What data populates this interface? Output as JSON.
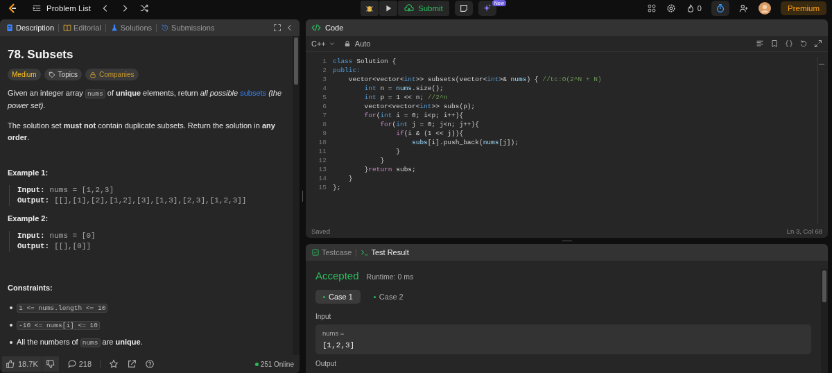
{
  "top_bar": {
    "problem_list": "Problem List",
    "submit": "Submit",
    "new_badge": "New",
    "streak": "0",
    "premium": "Premium"
  },
  "left_tabs": [
    {
      "label": "Description",
      "selected": true
    },
    {
      "label": "Editorial",
      "selected": false
    },
    {
      "label": "Solutions",
      "selected": false
    },
    {
      "label": "Submissions",
      "selected": false
    }
  ],
  "problem": {
    "title": "78. Subsets",
    "difficulty": "Medium",
    "topics": "Topics",
    "companies": "Companies",
    "statement": [
      {
        "kind": "text",
        "text": "Given an integer array "
      },
      {
        "kind": "code",
        "text": "nums"
      },
      {
        "kind": "text",
        "text": " of **unique** elements, return *all possible* "
      },
      {
        "kind": "link",
        "text": "subsets"
      },
      {
        "kind": "text",
        "text": " *(the power set)*."
      }
    ],
    "note": "The solution set **must not** contain duplicate subsets. Return the solution in **any order**.",
    "examples": [
      {
        "heading": "Example 1:",
        "lines": [
          {
            "label": "Input:",
            "value": "nums = [1,2,3]"
          },
          {
            "label": "Output:",
            "value": "[[],[1],[2],[1,2],[3],[1,3],[2,3],[1,2,3]]"
          }
        ]
      },
      {
        "heading": "Example 2:",
        "lines": [
          {
            "label": "Input:",
            "value": "nums = [0]"
          },
          {
            "label": "Output:",
            "value": "[[],[0]]"
          }
        ]
      }
    ],
    "constraints_heading": "Constraints:",
    "constraints": [
      [
        {
          "kind": "code",
          "text": "1 <= nums.length <= 10"
        }
      ],
      [
        {
          "kind": "code",
          "text": "-10 <= nums[i] <= 10"
        }
      ],
      [
        {
          "kind": "text",
          "text": "All the numbers of "
        },
        {
          "kind": "code",
          "text": "nums"
        },
        {
          "kind": "text",
          "text": " are **unique**."
        }
      ]
    ]
  },
  "footer": {
    "likes": "18.7K",
    "comments": "218",
    "online": "251 Online"
  },
  "code_panel": {
    "title": "Code",
    "language": "C++",
    "mode": "Auto",
    "status": "Saved",
    "cursor": "Ln 3, Col 68",
    "lines": [
      {
        "number": "1",
        "tokens": [
          {
            "kind": "type",
            "text": "class"
          },
          {
            "kind": "plain",
            "text": " Solution {"
          }
        ]
      },
      {
        "number": "2",
        "tokens": [
          {
            "kind": "type",
            "text": "public:"
          }
        ]
      },
      {
        "number": "3",
        "tokens": [
          {
            "kind": "plain",
            "text": "    vector<vector<"
          },
          {
            "kind": "type",
            "text": "int"
          },
          {
            "kind": "plain",
            "text": ">> subsets(vector<"
          },
          {
            "kind": "type",
            "text": "int"
          },
          {
            "kind": "plain",
            "text": ">& "
          },
          {
            "kind": "var",
            "text": "nums"
          },
          {
            "kind": "plain",
            "text": ") { "
          },
          {
            "kind": "comment",
            "text": "//tc:O(2^N + N)"
          }
        ]
      },
      {
        "number": "4",
        "tokens": [
          {
            "kind": "type",
            "text": "        int"
          },
          {
            "kind": "plain",
            "text": " n = "
          },
          {
            "kind": "var",
            "text": "nums"
          },
          {
            "kind": "plain",
            "text": ".size();"
          }
        ]
      },
      {
        "number": "5",
        "tokens": [
          {
            "kind": "type",
            "text": "        int"
          },
          {
            "kind": "plain",
            "text": " p = 1 << n; "
          },
          {
            "kind": "comment",
            "text": "//2^n"
          }
        ]
      },
      {
        "number": "6",
        "tokens": [
          {
            "kind": "plain",
            "text": "        vector<vector<"
          },
          {
            "kind": "type",
            "text": "int"
          },
          {
            "kind": "plain",
            "text": ">> subs(p);"
          }
        ]
      },
      {
        "number": "7",
        "tokens": [
          {
            "kind": "keyword",
            "text": "        for"
          },
          {
            "kind": "plain",
            "text": "("
          },
          {
            "kind": "type",
            "text": "int"
          },
          {
            "kind": "plain",
            "text": " i = 0; i<p; i++){"
          }
        ]
      },
      {
        "number": "8",
        "tokens": [
          {
            "kind": "keyword",
            "text": "            for"
          },
          {
            "kind": "plain",
            "text": "("
          },
          {
            "kind": "type",
            "text": "int"
          },
          {
            "kind": "plain",
            "text": " j = 0; j<n; j++){"
          }
        ]
      },
      {
        "number": "9",
        "tokens": [
          {
            "kind": "keyword",
            "text": "                if"
          },
          {
            "kind": "plain",
            "text": "(i & (1 << j)){"
          }
        ]
      },
      {
        "number": "10",
        "tokens": [
          {
            "kind": "var",
            "text": "                    subs"
          },
          {
            "kind": "plain",
            "text": "[i].push_back("
          },
          {
            "kind": "var",
            "text": "nums"
          },
          {
            "kind": "plain",
            "text": "[j]);"
          }
        ]
      },
      {
        "number": "11",
        "tokens": [
          {
            "kind": "plain",
            "text": "                }"
          }
        ]
      },
      {
        "number": "12",
        "tokens": [
          {
            "kind": "plain",
            "text": "            }"
          }
        ]
      },
      {
        "number": "13",
        "tokens": [
          {
            "kind": "plain",
            "text": "        }"
          },
          {
            "kind": "keyword",
            "text": "return"
          },
          {
            "kind": "plain",
            "text": " subs;"
          }
        ]
      },
      {
        "number": "14",
        "tokens": [
          {
            "kind": "plain",
            "text": "    }"
          }
        ]
      },
      {
        "number": "15",
        "tokens": [
          {
            "kind": "plain",
            "text": "};"
          }
        ]
      }
    ]
  },
  "test_panel": {
    "tabs": [
      {
        "label": "Testcase",
        "selected": false
      },
      {
        "label": "Test Result",
        "selected": true
      }
    ],
    "verdict": "Accepted",
    "runtime": "Runtime: 0 ms",
    "cases": [
      {
        "label": "Case 1",
        "selected": true,
        "passed": true
      },
      {
        "label": "Case 2",
        "selected": false,
        "passed": true
      }
    ],
    "input_label": "Input",
    "input_name": "nums =",
    "input_value": "[1,2,3]",
    "output_label": "Output"
  }
}
